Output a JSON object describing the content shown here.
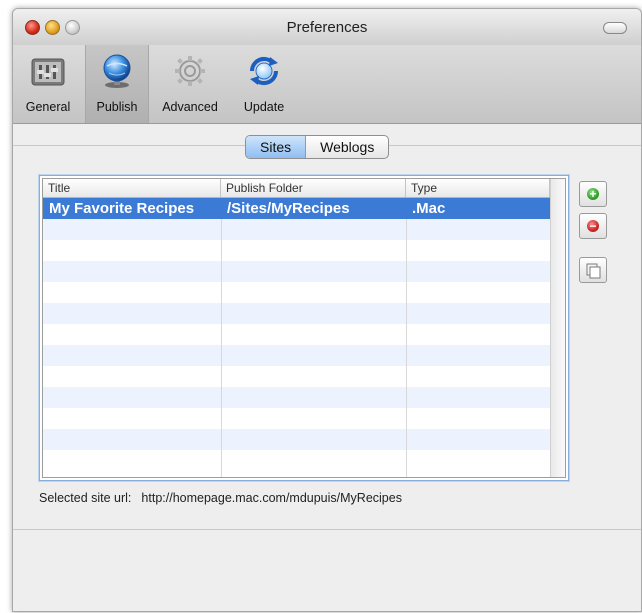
{
  "window": {
    "title": "Preferences"
  },
  "toolbar": {
    "items": [
      {
        "label": "General",
        "icon": "general-icon"
      },
      {
        "label": "Publish",
        "icon": "globe-icon"
      },
      {
        "label": "Advanced",
        "icon": "gear-icon"
      },
      {
        "label": "Update",
        "icon": "refresh-icon"
      }
    ],
    "selected": "Publish"
  },
  "tabs": {
    "items": [
      {
        "label": "Sites"
      },
      {
        "label": "Weblogs"
      }
    ],
    "selected": "Sites"
  },
  "table": {
    "columns": [
      "Title",
      "Publish Folder",
      "Type"
    ],
    "rows": [
      {
        "title": "My Favorite Recipes",
        "folder": "/Sites/MyRecipes",
        "type": ".Mac"
      }
    ],
    "selected_row": 0
  },
  "side_buttons": {
    "add": "add-icon",
    "remove": "remove-icon",
    "duplicate": "duplicate-icon"
  },
  "footer": {
    "url_label": "Selected site url:",
    "url_value": "http://homepage.mac.com/mdupuis/MyRecipes"
  },
  "colors": {
    "selection": "#3b7bd6",
    "alt_row": "#edf3fe",
    "accent_tab": "#8fbef2"
  }
}
